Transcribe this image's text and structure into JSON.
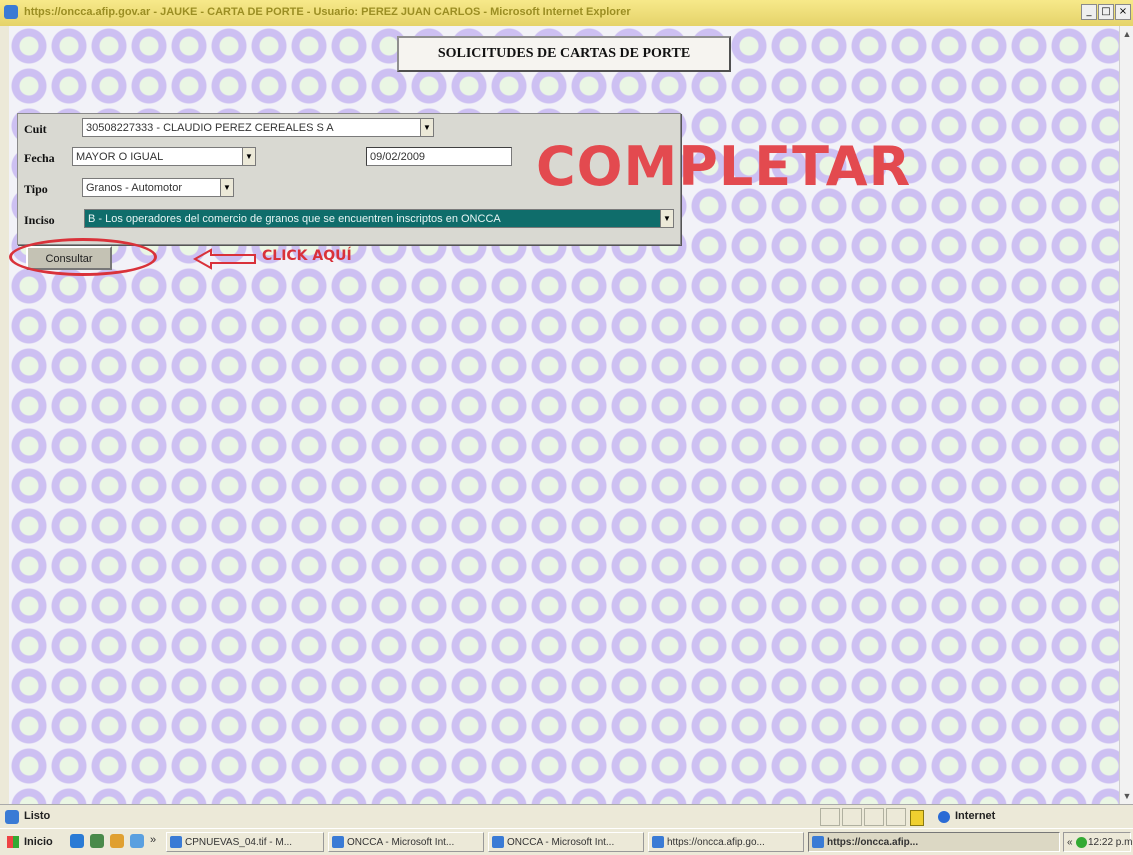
{
  "window": {
    "title": "https://oncca.afip.gov.ar - JAUKE - CARTA DE PORTE - Usuario: PEREZ JUAN CARLOS - Microsoft Internet Explorer",
    "minimize": "_",
    "maximize": "□",
    "close": "×"
  },
  "page": {
    "title": "SOLICITUDES DE CARTAS DE PORTE"
  },
  "form": {
    "cuit": {
      "label": "Cuit",
      "value": "30508227333 - CLAUDIO PEREZ CEREALES S A"
    },
    "fecha": {
      "label": "Fecha",
      "operator": "MAYOR O IGUAL",
      "date": "09/02/2009"
    },
    "tipo": {
      "label": "Tipo",
      "value": "Granos - Automotor"
    },
    "inciso": {
      "label": "Inciso",
      "value": "B - Los operadores del comercio de granos que se encuentren inscriptos en ONCCA"
    },
    "submit_label": "Consultar"
  },
  "annotations": {
    "click_here": "CLICK AQUÍ",
    "complete": "COMPLETAR",
    "accent_color": "#d9323a"
  },
  "statusbar": {
    "text": "Listo",
    "zone": "Internet"
  },
  "taskbar": {
    "start_label": "Inicio",
    "overflow": "»",
    "tasks": [
      {
        "label": "CPNUEVAS_04.tif - M..."
      },
      {
        "label": "ONCCA - Microsoft Int..."
      },
      {
        "label": "ONCCA - Microsoft Int..."
      },
      {
        "label": "https://oncca.afip.go..."
      },
      {
        "label": "https://oncca.afip..."
      }
    ],
    "tray_prefix": "«",
    "clock": "12:22 p.m."
  }
}
